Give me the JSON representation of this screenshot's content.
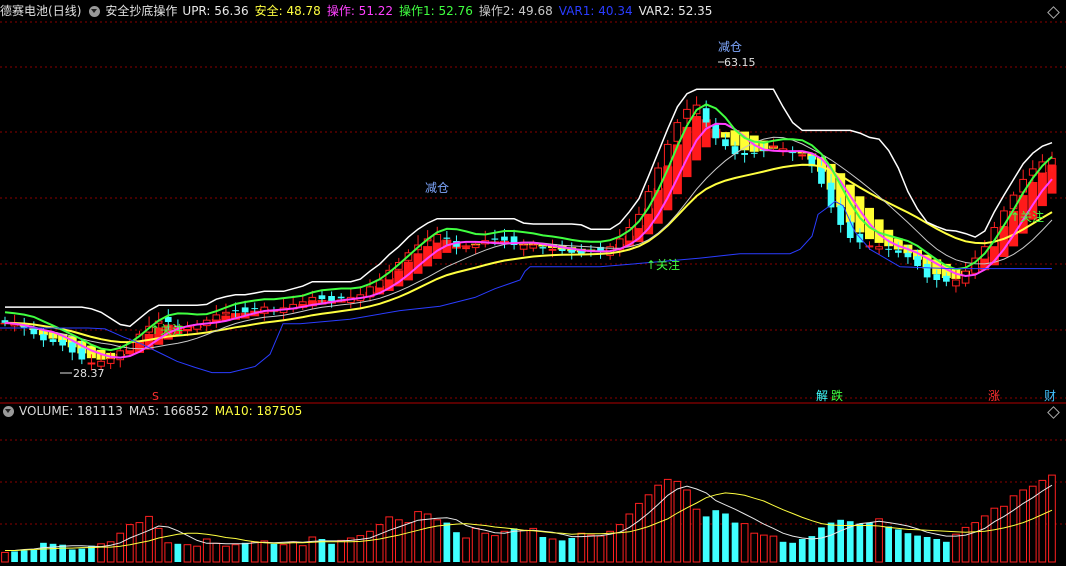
{
  "header": {
    "stock_name": "德赛电池",
    "period": "(日线)",
    "indicator_name": "安全抄底操作",
    "items": [
      {
        "label": "UPR: 56.36",
        "color": "#e8e8e8"
      },
      {
        "label": "安全: 48.78",
        "color": "#ffff40"
      },
      {
        "label": "操作: 51.22",
        "color": "#ff40ff"
      },
      {
        "label": "操作1: 52.76",
        "color": "#40ff40"
      },
      {
        "label": "操作2: 49.68",
        "color": "#c8c8c8"
      },
      {
        "label": "VAR1: 40.34",
        "color": "#2a3cff"
      },
      {
        "label": "VAR2: 52.35",
        "color": "#e8e8e8"
      }
    ]
  },
  "volume_header": {
    "items": [
      {
        "label": "VOLUME: 181113",
        "color": "#d8d8d8"
      },
      {
        "label": "MA5: 166852",
        "color": "#d8d8d8"
      },
      {
        "label": "MA10: 187505",
        "color": "#ffff40"
      }
    ]
  },
  "annotations": {
    "low_price": "28.37",
    "high_price": "63.15",
    "reduce_1": "减仓",
    "reduce_2": "减仓",
    "watch_1": "↑关注",
    "watch_2": "↑关注",
    "watch_3": "↑关注",
    "event_s": "S",
    "event_jie": "解",
    "event_die": "跌",
    "event_zhang": "涨",
    "event_cai": "财"
  },
  "colors": {
    "up": "#ff2020",
    "down": "#40ffff",
    "grid": "#8a0000",
    "white_line": "#ffffff",
    "yellow_line": "#ffff40",
    "magenta_line": "#ff40ff",
    "green_line": "#40ff40",
    "blue_line": "#2a3cff",
    "ribbon_red": "#ff1a1a",
    "ribbon_yellow": "#ffff33"
  },
  "chart_data": {
    "type": "candlestick",
    "price_range": [
      25,
      68
    ],
    "volume_range": [
      0,
      300000
    ],
    "close": [
      33.6,
      33.4,
      33.0,
      32.3,
      31.6,
      31.4,
      31.0,
      30.2,
      29.4,
      29.0,
      29.2,
      29.5,
      30.4,
      31.3,
      32.3,
      33.2,
      33.8,
      33.7,
      33.2,
      33.1,
      33.4,
      33.9,
      34.5,
      34.8,
      35.0,
      34.8,
      35.2,
      35.4,
      35.0,
      35.3,
      35.7,
      36.0,
      36.5,
      36.3,
      36.1,
      36.4,
      36.5,
      36.8,
      37.7,
      38.5,
      39.6,
      40.5,
      41.6,
      42.5,
      43.2,
      43.7,
      43.2,
      42.3,
      42.2,
      42.5,
      43.0,
      43.1,
      43.0,
      42.5,
      42.5,
      42.5,
      42.1,
      42.0,
      41.8,
      41.6,
      41.5,
      41.8,
      41.8,
      42.3,
      43.2,
      44.5,
      46.0,
      48.6,
      51.3,
      54.0,
      56.5,
      58.0,
      58.5,
      56.5,
      54.7,
      53.8,
      52.9,
      52.8,
      53.0,
      53.3,
      53.8,
      53.5,
      53.0,
      52.8,
      51.5,
      49.5,
      46.8,
      44.8,
      43.3,
      42.8,
      42.4,
      42.3,
      42.0,
      41.6,
      41.1,
      40.1,
      38.8,
      38.5,
      38.3,
      38.5,
      39.5,
      41.0,
      42.3,
      44.5,
      46.4,
      48.2,
      50.0,
      51.2,
      52.0,
      52.4
    ],
    "volume": [
      20,
      22,
      24,
      25,
      40,
      38,
      36,
      26,
      28,
      34,
      38,
      42,
      60,
      78,
      82,
      95,
      70,
      40,
      38,
      36,
      33,
      48,
      39,
      33,
      36,
      40,
      42,
      44,
      38,
      36,
      42,
      34,
      52,
      48,
      38,
      45,
      50,
      55,
      64,
      78,
      94,
      88,
      82,
      105,
      100,
      88,
      82,
      62,
      50,
      70,
      60,
      55,
      64,
      70,
      66,
      70,
      52,
      48,
      45,
      50,
      60,
      56,
      54,
      64,
      78,
      100,
      122,
      140,
      160,
      172,
      168,
      150,
      110,
      95,
      108,
      101,
      82,
      80,
      60,
      56,
      54,
      42,
      40,
      48,
      54,
      72,
      82,
      88,
      85,
      80,
      82,
      90,
      74,
      68,
      60,
      55,
      52,
      48,
      42,
      58,
      72,
      82,
      96,
      112,
      116,
      138,
      150,
      158,
      170,
      181
    ],
    "ma5": [
      24,
      24,
      26,
      27,
      30,
      31,
      33,
      34,
      34,
      33,
      32,
      35,
      40,
      50,
      58,
      66,
      75,
      73,
      65,
      55,
      45,
      39,
      39,
      38,
      38,
      38,
      40,
      41,
      40,
      41,
      42,
      41,
      43,
      44,
      44,
      44,
      45,
      47,
      50,
      58,
      66,
      73,
      80,
      87,
      89,
      91,
      92,
      88,
      76,
      70,
      66,
      61,
      60,
      64,
      65,
      66,
      64,
      62,
      58,
      53,
      53,
      54,
      55,
      58,
      62,
      72,
      86,
      102,
      120,
      139,
      152,
      158,
      152,
      144,
      128,
      119,
      110,
      100,
      90,
      79,
      70,
      60,
      54,
      50,
      48,
      50,
      56,
      65,
      73,
      80,
      82,
      85,
      82,
      79,
      75,
      69,
      62,
      58,
      54,
      54,
      56,
      62,
      70,
      84,
      95,
      108,
      122,
      134,
      148,
      160
    ],
    "ma10": [
      24,
      24,
      25,
      26,
      27,
      28,
      29,
      29,
      30,
      30,
      31,
      31,
      33,
      36,
      40,
      44,
      50,
      54,
      58,
      60,
      60,
      58,
      55,
      51,
      49,
      45,
      42,
      40,
      39,
      39,
      40,
      40,
      41,
      42,
      42,
      42,
      42,
      43,
      45,
      48,
      52,
      56,
      61,
      66,
      71,
      75,
      77,
      79,
      80,
      78,
      76,
      73,
      71,
      69,
      66,
      65,
      63,
      61,
      60,
      58,
      59,
      59,
      59,
      60,
      61,
      63,
      68,
      74,
      82,
      90,
      102,
      113,
      123,
      134,
      140,
      144,
      142,
      139,
      133,
      127,
      118,
      109,
      101,
      93,
      86,
      80,
      77,
      76,
      76,
      76,
      76,
      75,
      72,
      70,
      68,
      67,
      66,
      65,
      64,
      63,
      62,
      63,
      64,
      67,
      71,
      76,
      82,
      90,
      99,
      108
    ],
    "var1_blue": [
      [
        0,
        33.0
      ],
      [
        15,
        33.0
      ],
      [
        30,
        33.0
      ],
      [
        50,
        33.0
      ],
      [
        60,
        33.0
      ],
      [
        72,
        33.0
      ],
      [
        88,
        33.0
      ],
      [
        105,
        32.9
      ],
      [
        123,
        32.0
      ],
      [
        141,
        31.2
      ],
      [
        159,
        30.2
      ],
      [
        177,
        29.2
      ],
      [
        195,
        28.5
      ],
      [
        212,
        27.9
      ],
      [
        230,
        27.9
      ],
      [
        255,
        28.6
      ],
      [
        270,
        30.0
      ],
      [
        283,
        33.5
      ],
      [
        300,
        33.5
      ],
      [
        350,
        34.0
      ],
      [
        400,
        35.0
      ],
      [
        440,
        35.5
      ],
      [
        475,
        36.5
      ],
      [
        495,
        37.5
      ],
      [
        520,
        38.5
      ],
      [
        525,
        39.5
      ],
      [
        530,
        40.0
      ],
      [
        540,
        40.0
      ],
      [
        600,
        40.0
      ],
      [
        650,
        40.5
      ],
      [
        700,
        41.0
      ],
      [
        740,
        41.5
      ],
      [
        760,
        41.5
      ],
      [
        790,
        41.5
      ],
      [
        800,
        42.0
      ],
      [
        812,
        43.5
      ],
      [
        818,
        46.0
      ],
      [
        830,
        47.0
      ],
      [
        835,
        47.5
      ],
      [
        843,
        47.0
      ],
      [
        855,
        44.0
      ],
      [
        870,
        42.0
      ],
      [
        900,
        40.0
      ],
      [
        950,
        39.8
      ],
      [
        1000,
        39.8
      ],
      [
        1052,
        39.8
      ]
    ],
    "events": [
      "S",
      "解",
      "跌",
      "涨",
      "财"
    ],
    "x_axis": "daily bars (dates not shown)"
  }
}
